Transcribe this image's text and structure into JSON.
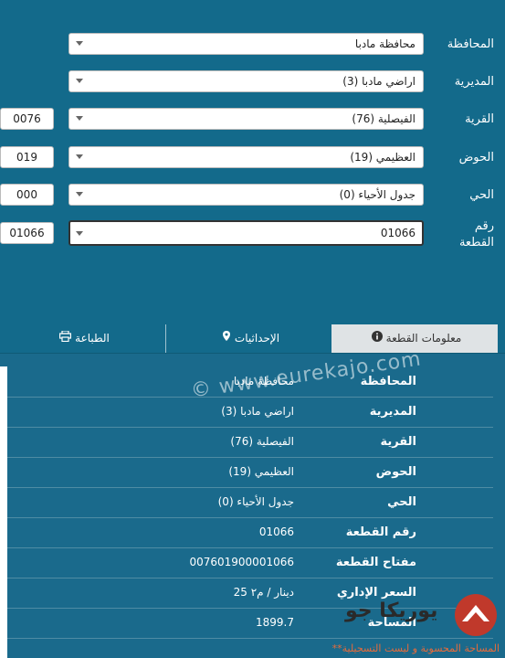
{
  "form": {
    "governorate": {
      "label": "المحافظة",
      "value": "محافظة مادبا"
    },
    "directorate": {
      "label": "المديرية",
      "value": "اراضي مادبا (3)"
    },
    "village": {
      "label": "القرية",
      "value": "الفيصلية (76)",
      "code": "0076"
    },
    "basin": {
      "label": "الحوض",
      "value": "العظيمي (19)",
      "code": "019"
    },
    "district": {
      "label": "الحي",
      "value": "جدول الأحياء (0)",
      "code": "000"
    },
    "plot": {
      "label": "رقم القطعة",
      "value": "01066",
      "code": "01066"
    }
  },
  "tabs": {
    "info": "معلومات القطعة",
    "coords": "الإحداثيات",
    "print": "الطباعة"
  },
  "details": [
    {
      "key": "المحافظة",
      "value": "محافظة مادبا"
    },
    {
      "key": "المديرية",
      "value": "اراضي مادبا (3)"
    },
    {
      "key": "القرية",
      "value": "الفيصلية (76)"
    },
    {
      "key": "الحوض",
      "value": "العظيمي (19)"
    },
    {
      "key": "الحي",
      "value": "جدول الأحياء (0)"
    },
    {
      "key": "رقم القطعة",
      "value": "01066"
    },
    {
      "key": "مفتاح القطعة",
      "value": "007601900001066"
    },
    {
      "key": "السعر الإداري",
      "value": "25 دينار / م٢"
    },
    {
      "key": "المساحة",
      "value": "1899.7"
    }
  ],
  "footnote": "**المساحة المحسوبة و ليست التسجيلية",
  "watermark": "© www.eurekajo.com",
  "logo_text": "يوريكا جو",
  "colors": {
    "background": "#136a8b",
    "accent": "#e86b3a"
  }
}
